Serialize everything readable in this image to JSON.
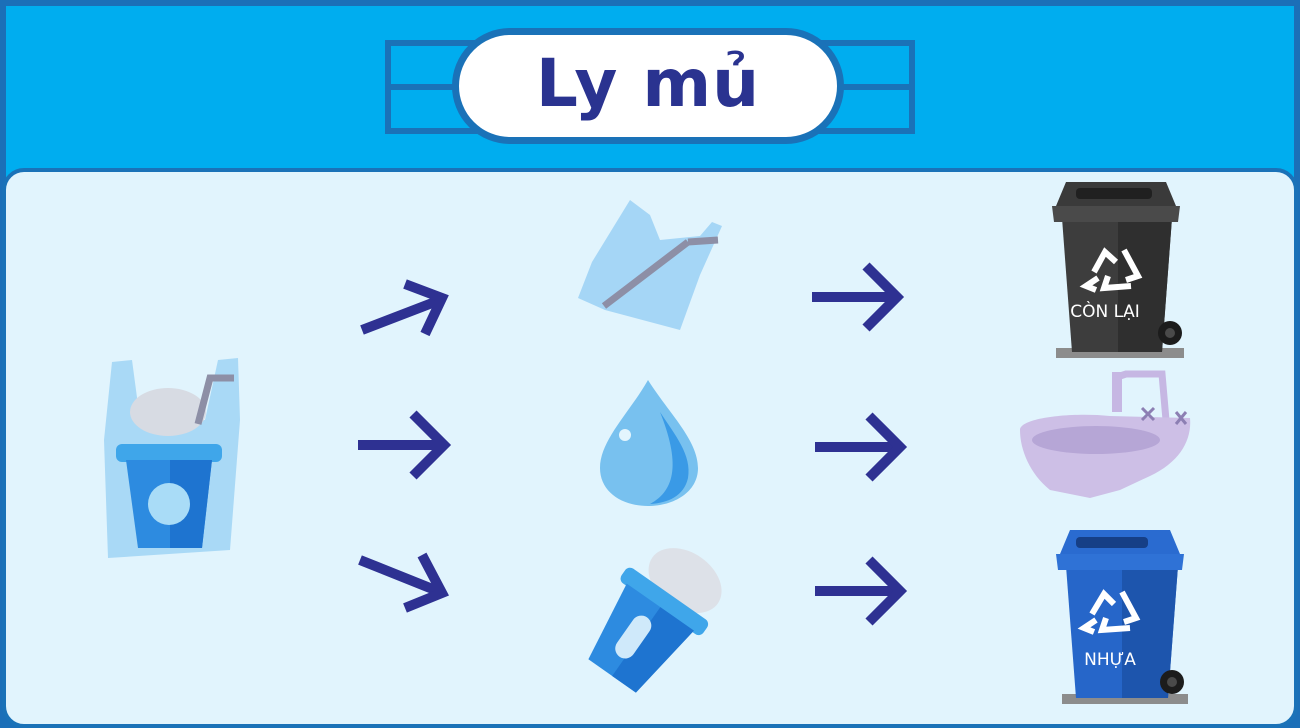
{
  "title": "Ly mủ",
  "bins": {
    "other_label": "CÒN LẠI",
    "plastic_label": "NHỰA"
  },
  "icons": {
    "source": "cup-in-plastic-bag-icon",
    "row1_item": "plastic-bag-with-straw-icon",
    "row1_dest": "gray-recycle-bin-icon",
    "row2_item": "water-drop-icon",
    "row2_dest": "sink-icon",
    "row3_item": "empty-plastic-cup-icon",
    "row3_dest": "blue-recycle-bin-icon",
    "arrow": "arrow-icon"
  },
  "colors": {
    "frame": "#00adef",
    "border": "#1a72b8",
    "panel": "#e1f4fd",
    "title_text": "#2a3390",
    "arrow": "#2e3192",
    "gray_bin": "#3d3d3d",
    "blue_bin": "#1f66d4"
  }
}
